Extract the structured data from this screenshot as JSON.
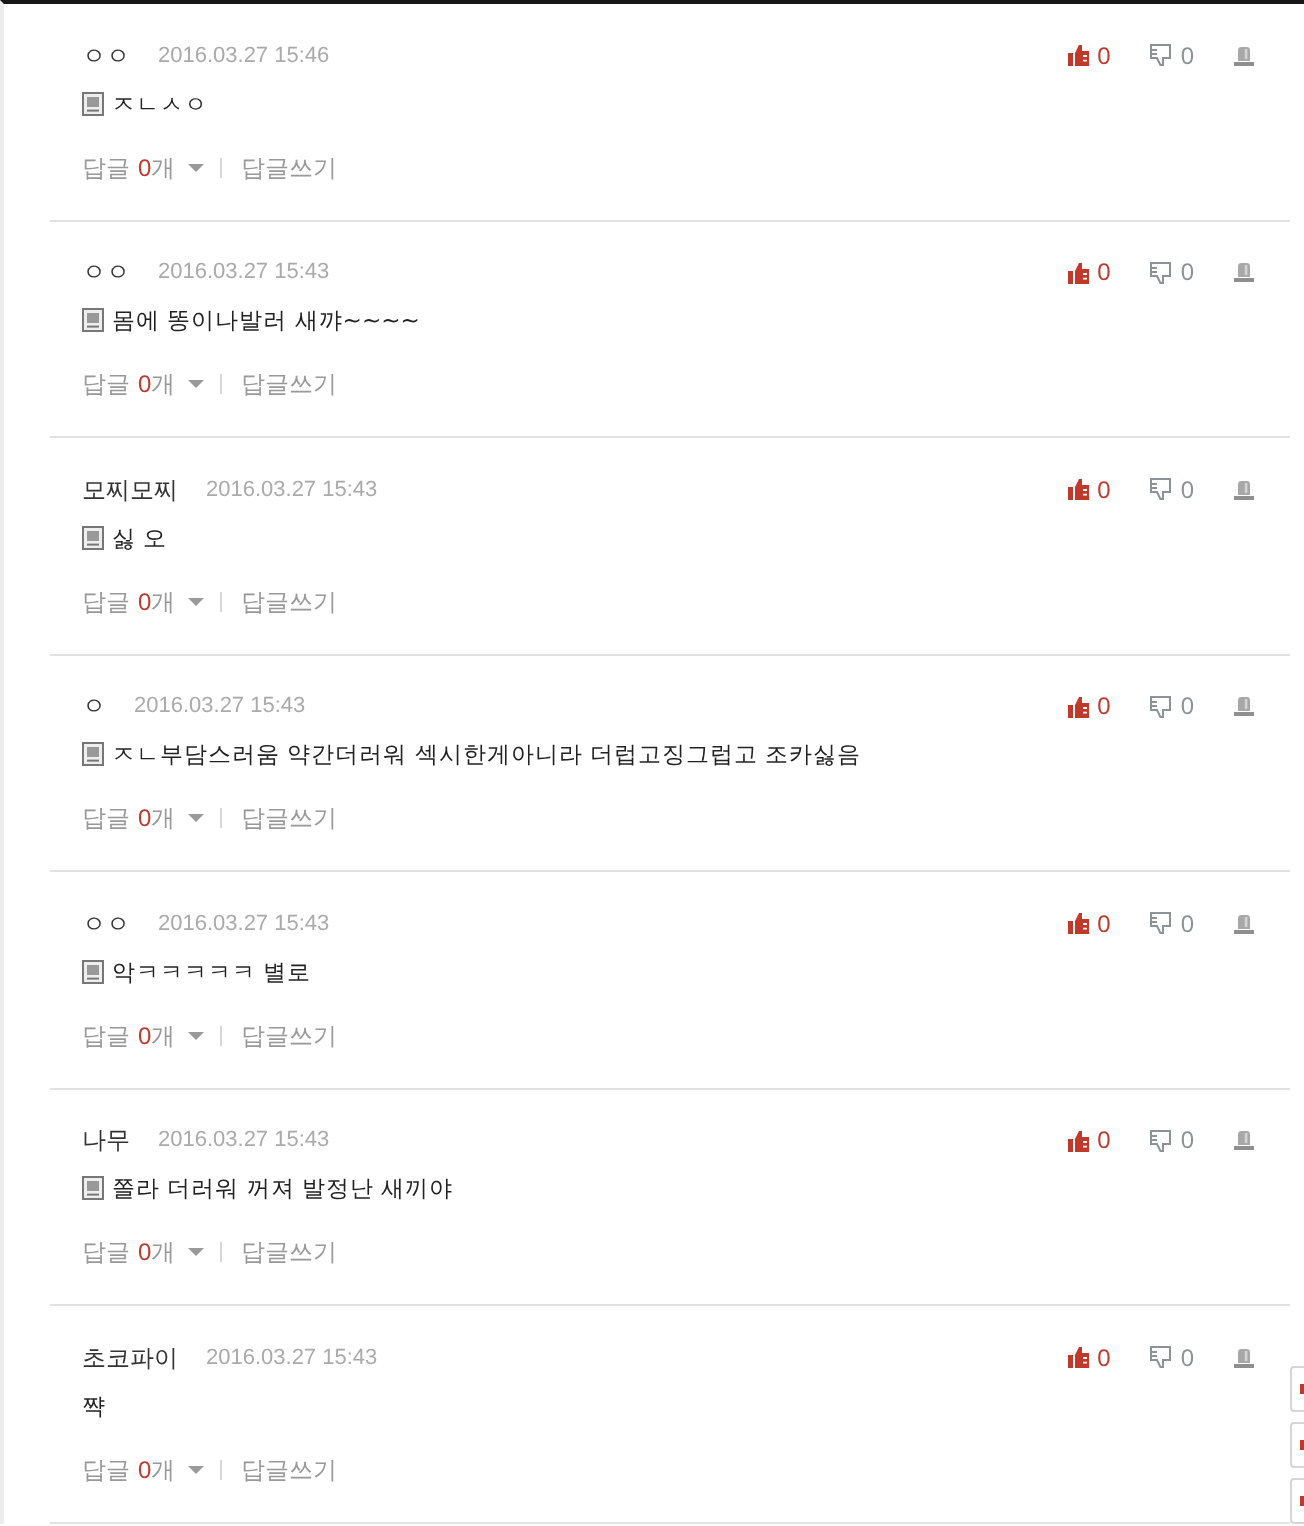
{
  "comments": [
    {
      "author": "ㅇㅇ",
      "date": "2016.03.27 15:46",
      "icon": true,
      "text": "ㅈㄴㅅㅇ",
      "likes": "0",
      "dislikes": "0",
      "replies": {
        "label": "답글",
        "count": "0",
        "unit": "개"
      },
      "write_reply": "답글쓰기"
    },
    {
      "author": "ㅇㅇ",
      "date": "2016.03.27 15:43",
      "icon": true,
      "text": "몸에 똥이나발러 새꺄~~~~",
      "likes": "0",
      "dislikes": "0",
      "replies": {
        "label": "답글",
        "count": "0",
        "unit": "개"
      },
      "write_reply": "답글쓰기"
    },
    {
      "author": "모찌모찌",
      "date": "2016.03.27 15:43",
      "icon": true,
      "text": "싫 오",
      "likes": "0",
      "dislikes": "0",
      "replies": {
        "label": "답글",
        "count": "0",
        "unit": "개"
      },
      "write_reply": "답글쓰기"
    },
    {
      "author": "ㅇ",
      "date": "2016.03.27 15:43",
      "icon": true,
      "text": "ㅈㄴ부담스러움 약간더러워 섹시한게아니라 더럽고징그럽고 조카싫음",
      "likes": "0",
      "dislikes": "0",
      "replies": {
        "label": "답글",
        "count": "0",
        "unit": "개"
      },
      "write_reply": "답글쓰기"
    },
    {
      "author": "ㅇㅇ",
      "date": "2016.03.27 15:43",
      "icon": true,
      "text": "악ㅋㅋㅋㅋㅋ 별로",
      "likes": "0",
      "dislikes": "0",
      "replies": {
        "label": "답글",
        "count": "0",
        "unit": "개"
      },
      "write_reply": "답글쓰기"
    },
    {
      "author": "나무",
      "date": "2016.03.27 15:43",
      "icon": true,
      "text": "쫄라 더러워 꺼져 발정난 새끼야",
      "likes": "0",
      "dislikes": "0",
      "replies": {
        "label": "답글",
        "count": "0",
        "unit": "개"
      },
      "write_reply": "답글쓰기"
    },
    {
      "author": "초코파이",
      "date": "2016.03.27 15:43",
      "icon": false,
      "text": "쨕",
      "likes": "0",
      "dislikes": "0",
      "replies": {
        "label": "답글",
        "count": "0",
        "unit": "개"
      },
      "write_reply": "답글쓰기"
    }
  ]
}
